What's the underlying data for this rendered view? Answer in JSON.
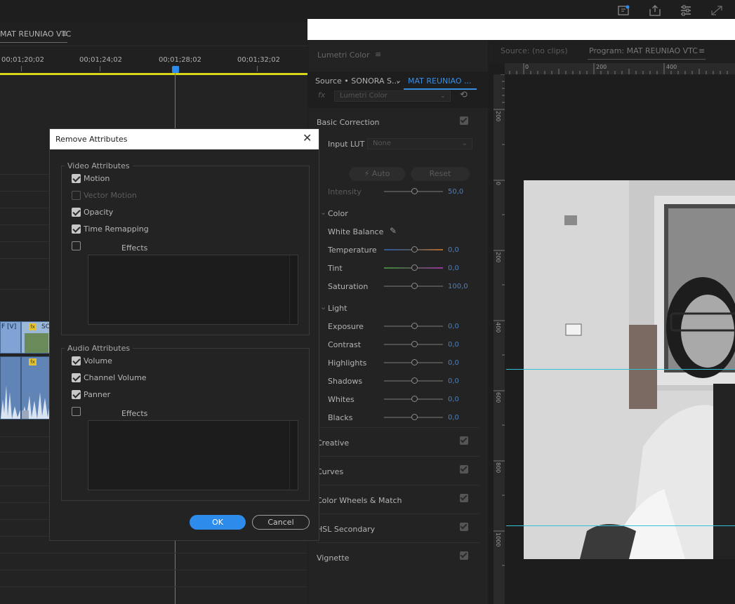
{
  "timeline": {
    "tab_label": "MAT REUNIAO VTC",
    "menu_glyph": "≡",
    "timecodes": [
      "00;01;20;02",
      "00;01;24;02",
      "00;01;28;02",
      "00;01;32;02"
    ],
    "clip_v_label": "F [V]",
    "clip_v2_label": "SO"
  },
  "dialog": {
    "title": "Remove Attributes",
    "video_group_title": "Video Attributes",
    "video_items": [
      {
        "label": "Motion",
        "checked": true,
        "enabled": true
      },
      {
        "label": "Vector Motion",
        "checked": false,
        "enabled": false
      },
      {
        "label": "Opacity",
        "checked": true,
        "enabled": true
      },
      {
        "label": "Time Remapping",
        "checked": true,
        "enabled": true
      }
    ],
    "video_effects_label": "Effects",
    "audio_group_title": "Audio Attributes",
    "audio_items": [
      {
        "label": "Volume",
        "checked": true
      },
      {
        "label": "Channel Volume",
        "checked": true
      },
      {
        "label": "Panner",
        "checked": true
      }
    ],
    "audio_effects_label": "Effects",
    "ok_label": "OK",
    "cancel_label": "Cancel"
  },
  "lumetri": {
    "tab_label": "Lumetri Color",
    "menu_glyph": "≡",
    "source_label": "Source • SONORA S...",
    "sequence_label": "MAT REUNIAO ...",
    "fx_label": "fx",
    "effect_dropdown": "Lumetri Color",
    "basic_correction": "Basic Correction",
    "input_lut_label": "Input LUT",
    "input_lut_value": "None",
    "auto_label": "Auto",
    "reset_label": "Reset",
    "intensity_label": "Intensity",
    "intensity_value": "50,0",
    "color_heading": "Color",
    "white_balance_label": "White Balance",
    "color_sliders": [
      {
        "label": "Temperature",
        "value": "0,0"
      },
      {
        "label": "Tint",
        "value": "0,0"
      },
      {
        "label": "Saturation",
        "value": "100,0"
      }
    ],
    "light_heading": "Light",
    "light_sliders": [
      {
        "label": "Exposure",
        "value": "0,0"
      },
      {
        "label": "Contrast",
        "value": "0,0"
      },
      {
        "label": "Highlights",
        "value": "0,0"
      },
      {
        "label": "Shadows",
        "value": "0,0"
      },
      {
        "label": "Whites",
        "value": "0,0"
      },
      {
        "label": "Blacks",
        "value": "0,0"
      }
    ],
    "sections": [
      "Creative",
      "Curves",
      "Color Wheels & Match",
      "HSL Secondary",
      "Vignette"
    ]
  },
  "monitor": {
    "source_tab": "Source: (no clips)",
    "program_tab": "Program: MAT REUNIAO VTC",
    "menu_glyph": "≡",
    "h_ruler": [
      "0",
      "200",
      "400"
    ],
    "v_ruler": [
      "200",
      "0",
      "200",
      "400",
      "600",
      "800",
      "1000"
    ]
  },
  "top_icons": [
    "workspace-icon",
    "export-icon",
    "panels-icon",
    "fullscreen-icon"
  ]
}
